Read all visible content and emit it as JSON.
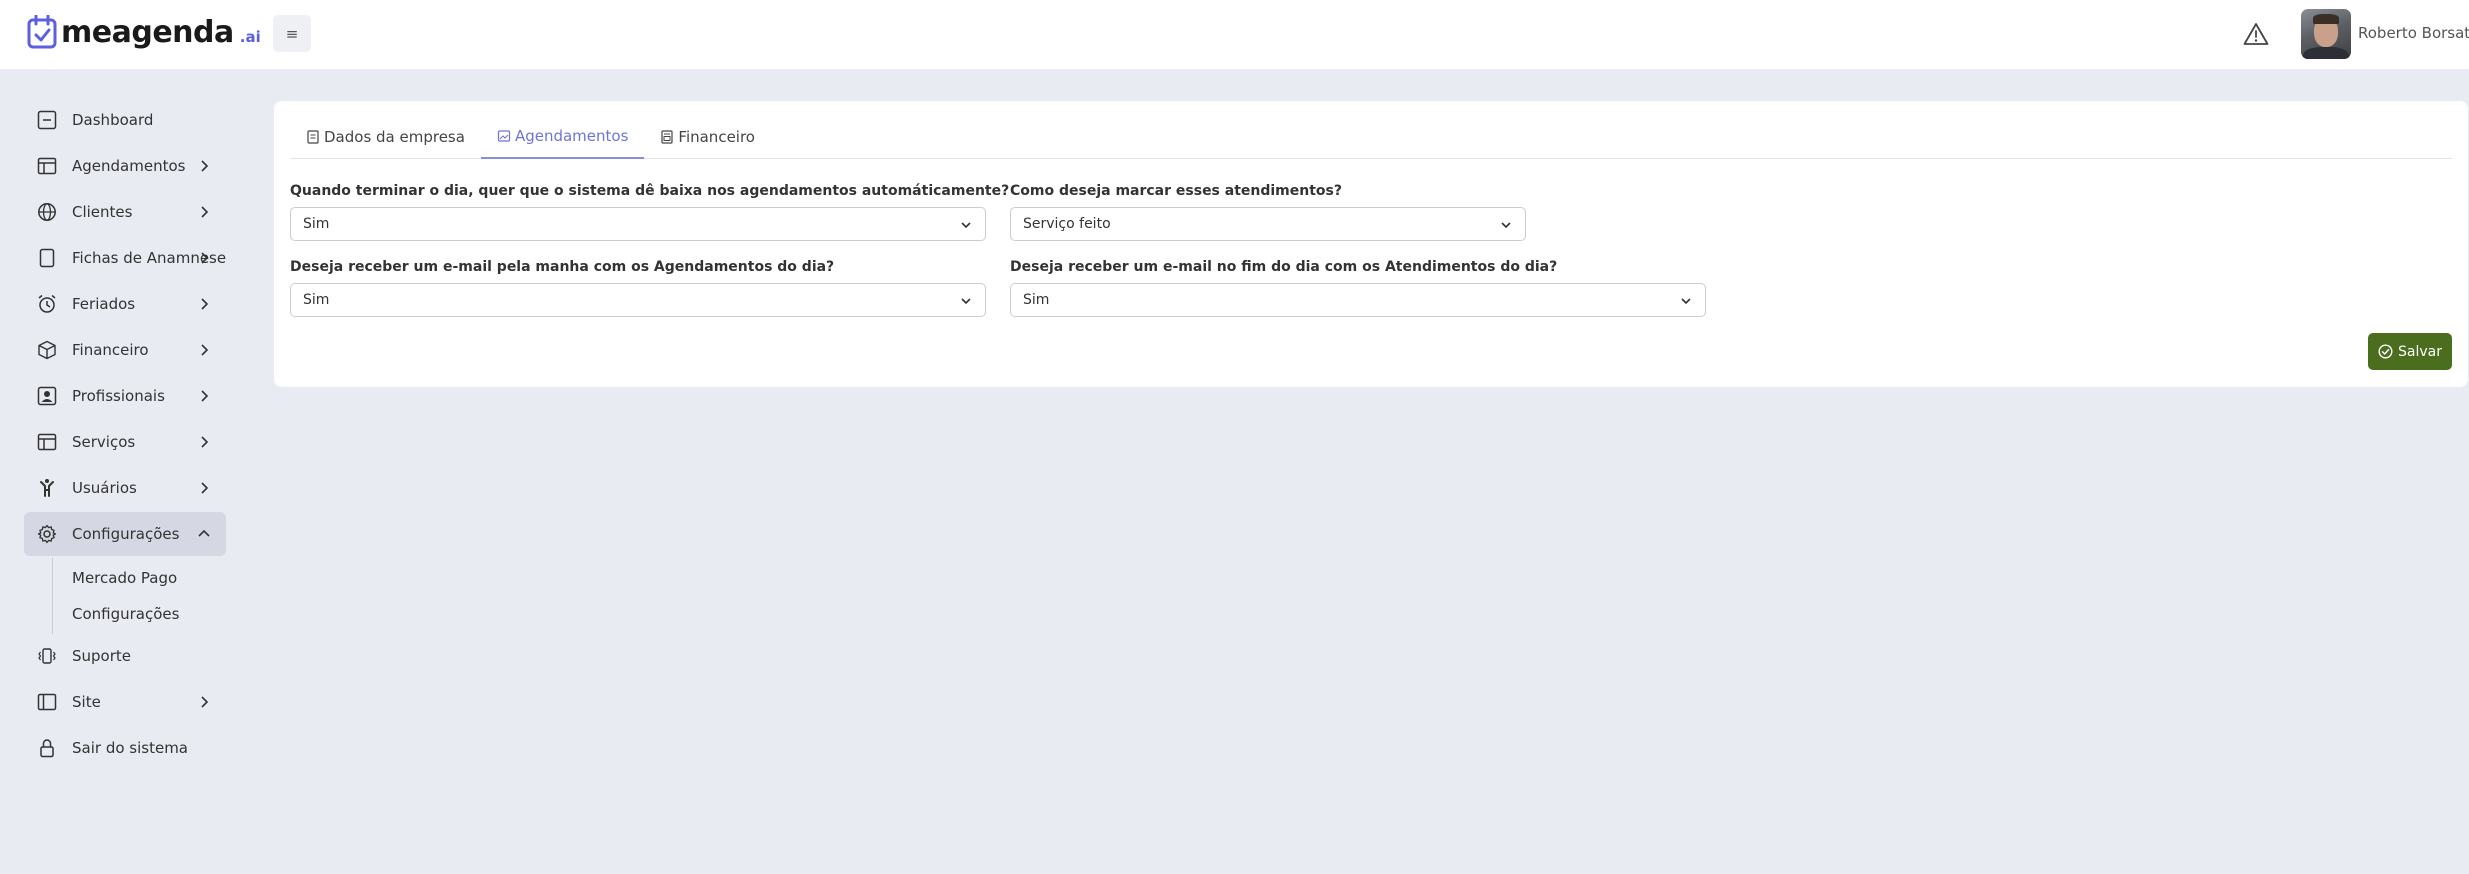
{
  "header": {
    "logo_text": "meagenda",
    "logo_suffix": ".ai",
    "menu_toggle": "≡",
    "user_name": "Roberto Borsatti"
  },
  "sidebar": {
    "items": [
      {
        "label": "Dashboard",
        "icon": "dashboard-icon"
      },
      {
        "label": "Agendamentos",
        "icon": "calendar-table-icon"
      },
      {
        "label": "Clientes",
        "icon": "globe-icon"
      },
      {
        "label": "Fichas de Anamnese",
        "icon": "tablet-icon"
      },
      {
        "label": "Feriados",
        "icon": "alarm-clock-icon"
      },
      {
        "label": "Financeiro",
        "icon": "box-icon"
      },
      {
        "label": "Profissionais",
        "icon": "id-card-icon"
      },
      {
        "label": "Serviços",
        "icon": "table-icon"
      },
      {
        "label": "Usuários",
        "icon": "person-icon"
      },
      {
        "label": "Configurações",
        "icon": "gear-icon"
      },
      {
        "label": "Suporte",
        "icon": "vibrate-icon"
      },
      {
        "label": "Site",
        "icon": "layout-icon"
      },
      {
        "label": "Sair do sistema",
        "icon": "lock-icon"
      }
    ],
    "submenu": [
      "Mercado Pago",
      "Configurações"
    ]
  },
  "tabs": [
    "Dados da empresa",
    "Agendamentos",
    "Financeiro"
  ],
  "form": {
    "q1": {
      "label": "Quando terminar o dia, quer que o sistema dê baixa nos agendamentos automáticamente?",
      "value": "Sim"
    },
    "q2": {
      "label": "Como deseja marcar esses atendimentos?",
      "value": "Serviço feito"
    },
    "q3": {
      "label": "Deseja receber um e-mail pela manha com os Agendamentos do dia?",
      "value": "Sim"
    },
    "q4": {
      "label": "Deseja receber um e-mail no fim do dia com os Atendimentos do dia?",
      "value": "Sim"
    }
  },
  "save_label": "Salvar",
  "colors": {
    "background": "#e9ebf3",
    "accent": "#6f73d6",
    "save_button": "#4a6e1e",
    "active_nav": "#d5d8e3"
  }
}
